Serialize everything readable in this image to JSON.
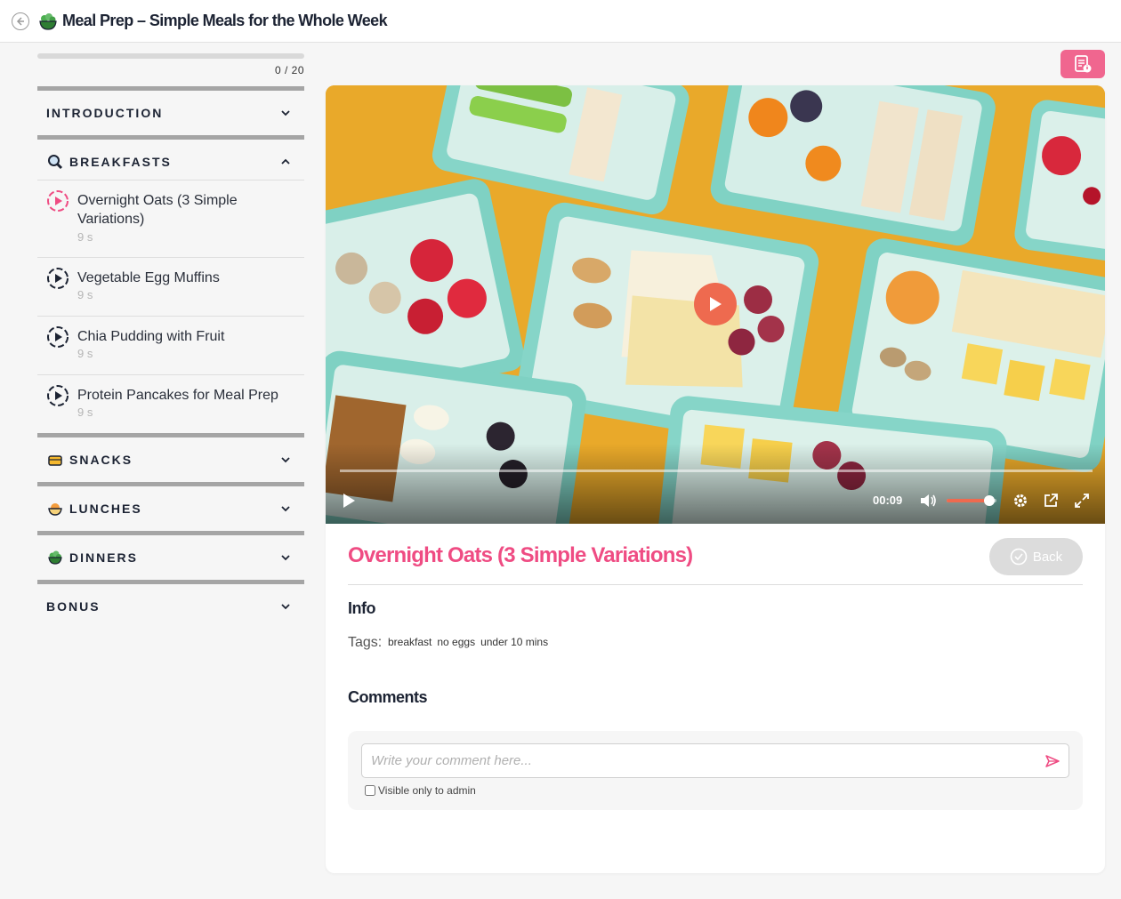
{
  "header": {
    "title": "Meal Prep – Simple Meals for the Whole Week"
  },
  "sidebar": {
    "progress": {
      "completed": 0,
      "total": 20,
      "label": "0 / 20"
    },
    "sections": [
      {
        "title": "INTRODUCTION",
        "icon": "none",
        "expanded": false
      },
      {
        "title": "BREAKFASTS",
        "icon": "magnifier-icon",
        "expanded": true,
        "lessons": [
          {
            "title": "Overnight Oats (3 Simple Variations)",
            "duration": "9 s",
            "active": true
          },
          {
            "title": "Vegetable Egg Muffins",
            "duration": "9 s",
            "active": false
          },
          {
            "title": "Chia Pudding with Fruit",
            "duration": "9 s",
            "active": false
          },
          {
            "title": "Protein Pancakes for Meal Prep",
            "duration": "9 s",
            "active": false
          }
        ]
      },
      {
        "title": "SNACKS",
        "icon": "lunchbox-icon",
        "expanded": false
      },
      {
        "title": "LUNCHES",
        "icon": "bowl-icon",
        "expanded": false
      },
      {
        "title": "DINNERS",
        "icon": "salad-bowl-icon",
        "expanded": false
      },
      {
        "title": "BONUS",
        "icon": "none",
        "expanded": false
      }
    ]
  },
  "player": {
    "time": "00:09",
    "volume": 0.85,
    "progress": 0
  },
  "lesson": {
    "title": "Overnight Oats (3 Simple Variations)",
    "back_label": "Back",
    "info_heading": "Info",
    "tags_label": "Tags:",
    "tags": [
      "breakfast",
      "no eggs",
      "under 10 mins"
    ],
    "comments_heading": "Comments",
    "comment_placeholder": "Write your comment here...",
    "visible_admin_label": "Visible only to admin"
  },
  "colors": {
    "accent": "#ef4c83",
    "play": "#ee6a4f",
    "video_bg": "#e8a528",
    "container": "#7fd3c5"
  }
}
